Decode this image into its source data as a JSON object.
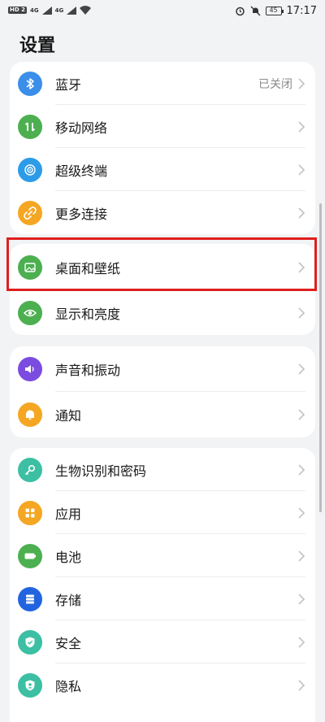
{
  "status": {
    "left_badge": "HD 2",
    "net1": "4G",
    "net2": "4G",
    "battery": "45",
    "time": "17:17"
  },
  "page": {
    "title": "设置"
  },
  "groups": [
    {
      "items": [
        {
          "label": "蓝牙",
          "value": "已关闭",
          "icon": "bluetooth-icon",
          "color": "#3b8eea"
        },
        {
          "label": "移动网络",
          "icon": "mobile-data-icon",
          "color": "#4caf50"
        },
        {
          "label": "超级终端",
          "icon": "super-device-icon",
          "color": "#2d9ce8"
        },
        {
          "label": "更多连接",
          "icon": "link-icon",
          "color": "#f5a623"
        }
      ]
    },
    {
      "items": [
        {
          "label": "桌面和壁纸",
          "icon": "wallpaper-icon",
          "color": "#4caf50"
        },
        {
          "label": "显示和亮度",
          "icon": "eye-icon",
          "color": "#4caf50"
        }
      ]
    },
    {
      "items": [
        {
          "label": "声音和振动",
          "icon": "sound-icon",
          "color": "#7b4ce0"
        },
        {
          "label": "通知",
          "icon": "bell-icon",
          "color": "#f5a623"
        }
      ]
    },
    {
      "items": [
        {
          "label": "生物识别和密码",
          "icon": "key-icon",
          "color": "#3cbfa3"
        },
        {
          "label": "应用",
          "icon": "apps-icon",
          "color": "#f5a623"
        },
        {
          "label": "电池",
          "icon": "battery-icon",
          "color": "#4caf50"
        },
        {
          "label": "存储",
          "icon": "storage-icon",
          "color": "#2264e0"
        },
        {
          "label": "安全",
          "icon": "shield-icon",
          "color": "#3cbfa3"
        },
        {
          "label": "隐私",
          "icon": "privacy-icon",
          "color": "#3cbfa3"
        }
      ]
    }
  ]
}
